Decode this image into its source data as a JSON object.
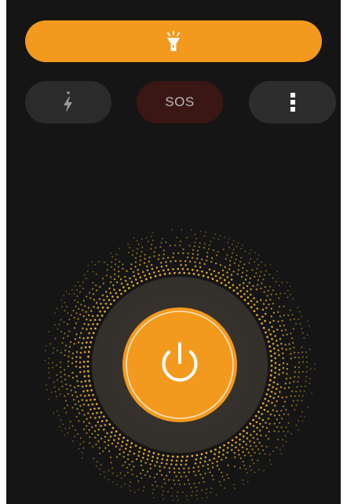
{
  "top_bar": {
    "icon": "flashlight-icon",
    "active": true
  },
  "modes": {
    "flash_icon": "flash-timer-icon",
    "sos_label": "SOS",
    "more_icon": "more-vertical-icon"
  },
  "power": {
    "icon": "power-icon",
    "state": "on"
  },
  "colors": {
    "accent": "#f39a1e",
    "background": "#151515",
    "pill_dark": "#2b2b2b",
    "sos_bg": "#3a1715",
    "dial_ring": "#3b3630",
    "glow_dots": "#f5b82a"
  }
}
